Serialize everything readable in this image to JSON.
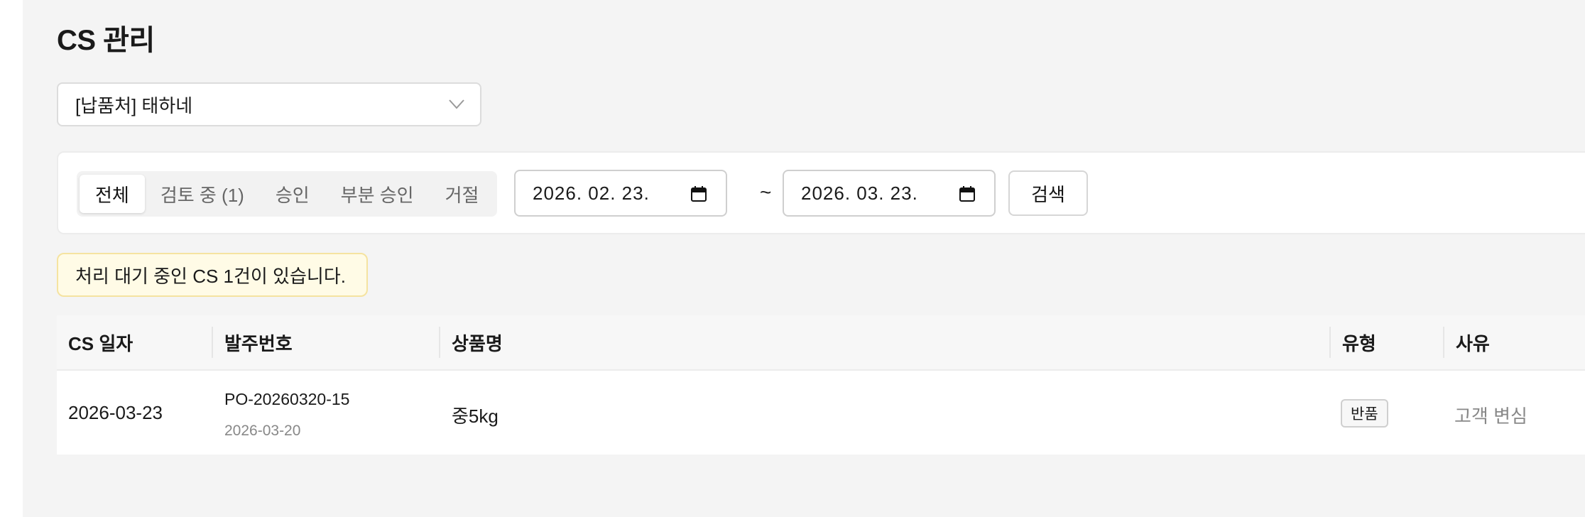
{
  "page": {
    "title": "CS 관리"
  },
  "vendor_select": {
    "value": "[납품처] 태하네"
  },
  "filters": {
    "tabs": [
      {
        "label": "전체",
        "active": true
      },
      {
        "label": "검토 중 (1)",
        "active": false
      },
      {
        "label": "승인",
        "active": false
      },
      {
        "label": "부분 승인",
        "active": false
      },
      {
        "label": "거절",
        "active": false
      }
    ],
    "date_from": "2026. 02. 23.",
    "date_separator": "~",
    "date_to": "2026. 03. 23.",
    "search_label": "검색"
  },
  "notice": {
    "text": "처리 대기 중인 CS 1건이 있습니다."
  },
  "table": {
    "columns": [
      "CS 일자",
      "발주번호",
      "상품명",
      "유형",
      "사유"
    ],
    "rows": [
      {
        "cs_date": "2026-03-23",
        "po_number": "PO-20260320-15",
        "po_date": "2026-03-20",
        "product": "중5kg",
        "type": "반품",
        "reason": "고객 변심"
      }
    ]
  },
  "colors": {
    "background": "#f4f4f4",
    "notice_bg": "#fffbe6",
    "notice_border": "#f5e3a0"
  }
}
